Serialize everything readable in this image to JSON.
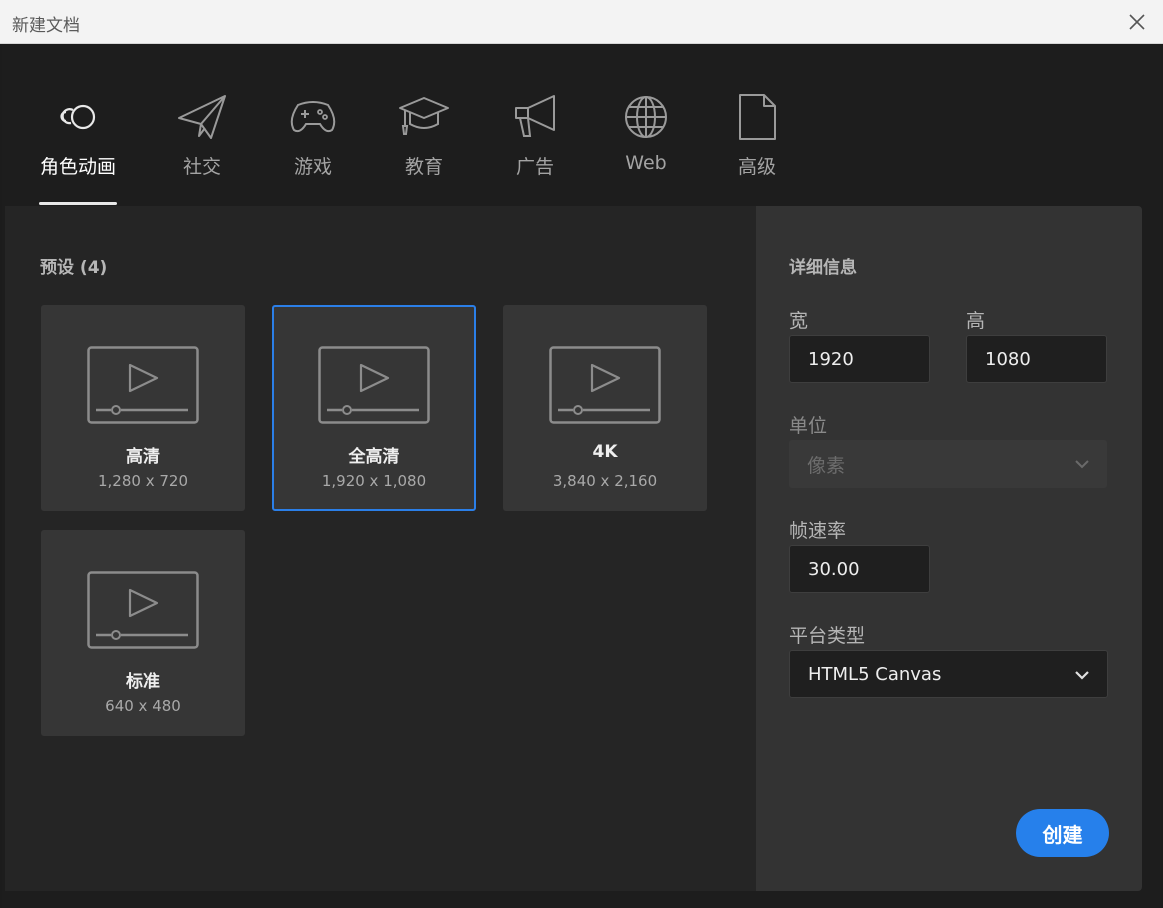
{
  "window": {
    "title": "新建文档"
  },
  "tabs": [
    {
      "label": "角色动画",
      "icon": "character-animation-icon",
      "active": true
    },
    {
      "label": "社交",
      "icon": "paper-plane-icon",
      "active": false
    },
    {
      "label": "游戏",
      "icon": "gamepad-icon",
      "active": false
    },
    {
      "label": "教育",
      "icon": "graduation-cap-icon",
      "active": false
    },
    {
      "label": "广告",
      "icon": "megaphone-icon",
      "active": false
    },
    {
      "label": "Web",
      "icon": "globe-icon",
      "active": false
    },
    {
      "label": "高级",
      "icon": "document-icon",
      "active": false
    }
  ],
  "presets": {
    "title": "预设 (4)",
    "items": [
      {
        "name": "高清",
        "size": "1,280 x 720",
        "selected": false
      },
      {
        "name": "全高清",
        "size": "1,920 x 1,080",
        "selected": true
      },
      {
        "name": "4K",
        "size": "3,840 x 2,160",
        "selected": false
      },
      {
        "name": "标准",
        "size": "640 x 480",
        "selected": false
      }
    ]
  },
  "details": {
    "title": "详细信息",
    "width_label": "宽",
    "width_value": "1920",
    "height_label": "高",
    "height_value": "1080",
    "unit_label": "单位",
    "unit_value": "像素",
    "fps_label": "帧速率",
    "fps_value": "30.00",
    "platform_label": "平台类型",
    "platform_value": "HTML5 Canvas"
  },
  "actions": {
    "create_label": "创建"
  },
  "colors": {
    "accent": "#2680eb",
    "selected_border": "#2b7fe8"
  }
}
